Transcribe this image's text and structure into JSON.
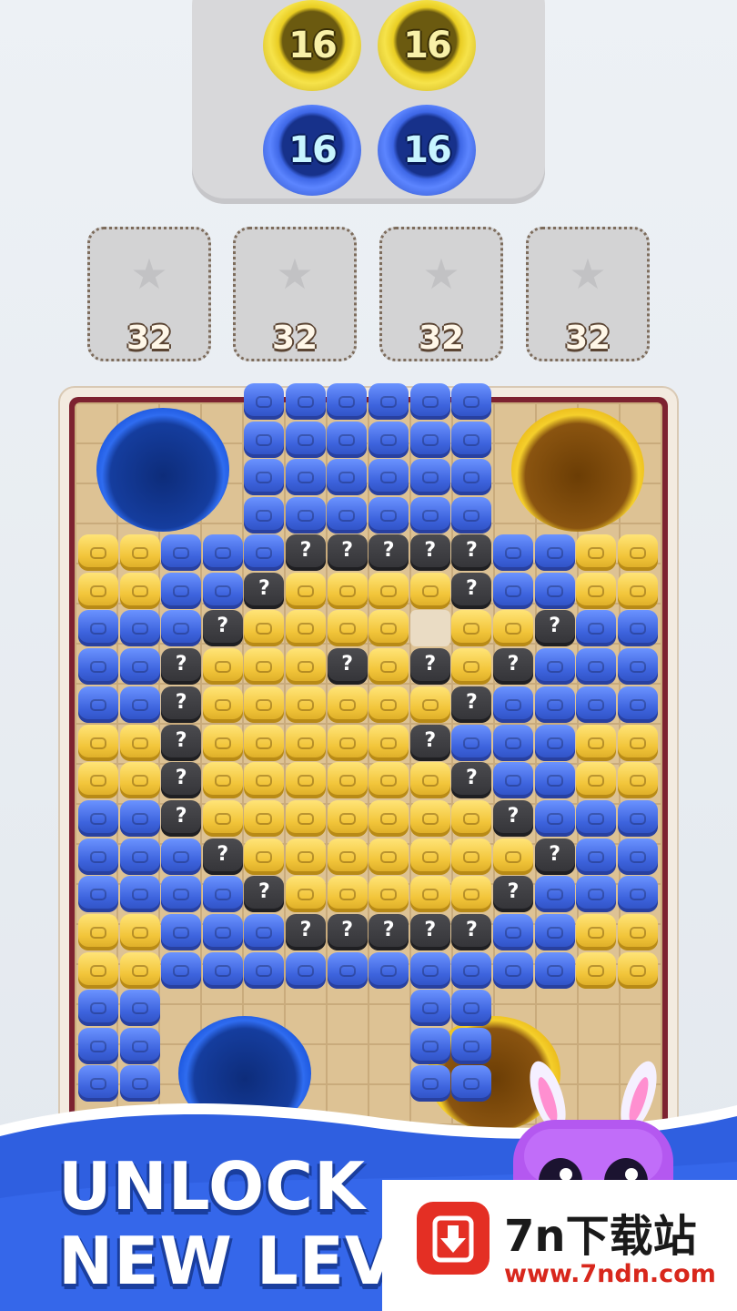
{
  "colors": {
    "blue": "#3e64de",
    "yellow": "#f2c53a",
    "mystery": "#3a3a3e",
    "board_frame": "#7d2230",
    "board_floor": "#ddc294",
    "banner_blue": "#2f5fe0"
  },
  "collector_tray": {
    "tokens": [
      {
        "color": "yellow",
        "value": "16"
      },
      {
        "color": "yellow",
        "value": "16"
      },
      {
        "color": "blue",
        "value": "16"
      },
      {
        "color": "blue",
        "value": "16"
      }
    ]
  },
  "slots": [
    {
      "icon": "star-icon",
      "capacity": "32"
    },
    {
      "icon": "star-icon",
      "capacity": "32"
    },
    {
      "icon": "star-icon",
      "capacity": "32"
    },
    {
      "icon": "star-icon",
      "capacity": "32"
    }
  ],
  "board": {
    "mystery_symbol": "?",
    "holes": [
      {
        "position": "top-left",
        "color": "blue"
      },
      {
        "position": "top-right",
        "color": "yellow"
      },
      {
        "position": "bottom-left",
        "color": "blue"
      },
      {
        "position": "bottom-right",
        "color": "yellow"
      }
    ],
    "top_rows": [
      "..BBBBBB..",
      "..BBBBBB..",
      "..BBBBBB..",
      "..BBBBBB.."
    ],
    "rows": [
      "YYBBBMMMMMBBYY",
      "YYBBMYYYYMBBYY",
      "BBBMYYYYYYYMBB",
      "BBMYYYMYMYMBBB",
      "BBMYYYYYYMBBBB",
      "YYMYYYYYMBBBYY",
      "YYMYYYYYYMBBYY",
      "BBMYYYYYYYMBBB",
      "BBBMYYYYYYYMBB",
      "BBBBMYYYYYMBBB",
      "YYBBBMMMMMBBYY",
      "YYBBBBBBBBBBYY"
    ],
    "bottom_rows": [
      "BB......BB..",
      "BB......BB..",
      "BB......BB.."
    ]
  },
  "banner": {
    "line1": "UNLOCK",
    "line2": "NEW LEVEL"
  },
  "watermark": {
    "title": "7n下载站",
    "url": "www.7ndn.com"
  }
}
